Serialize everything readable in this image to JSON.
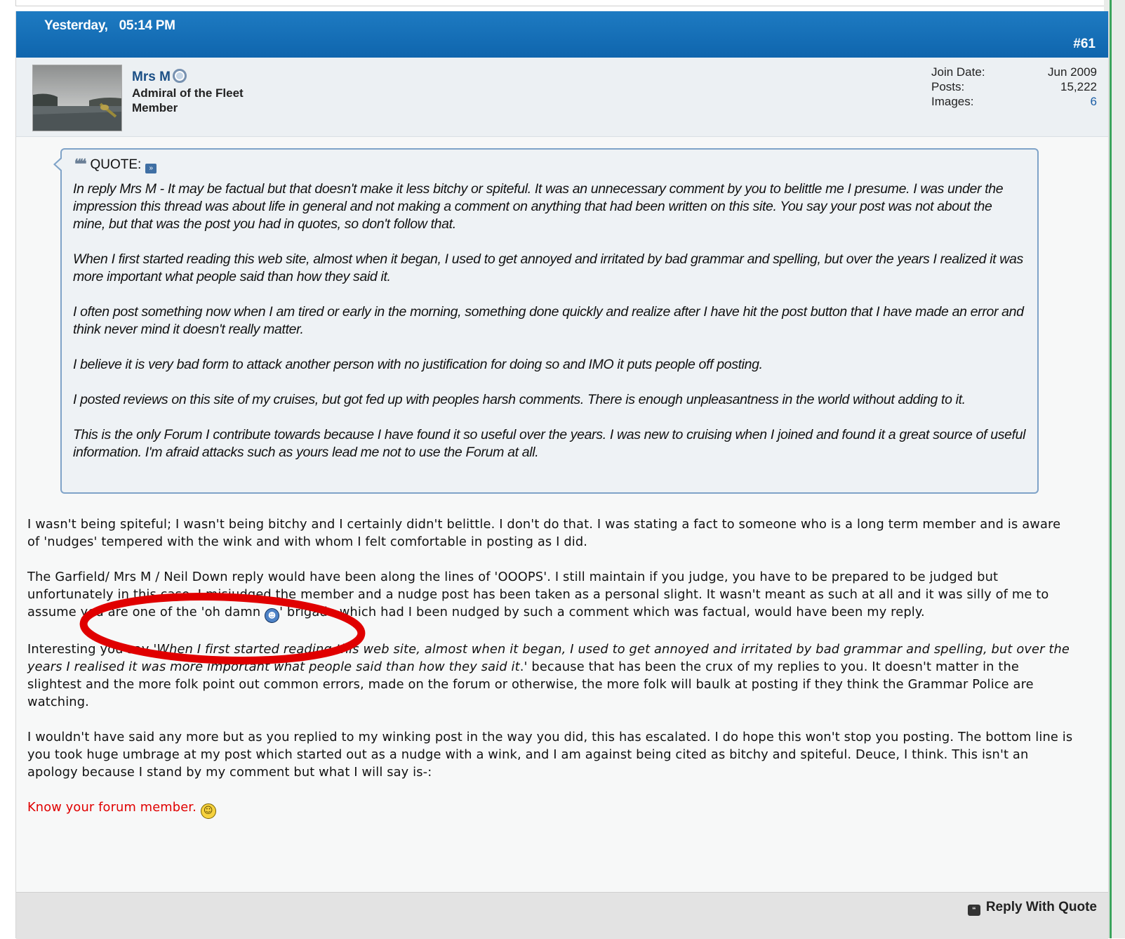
{
  "post": {
    "date": "Yesterday,",
    "time": "05:14 PM",
    "number": "#61"
  },
  "user": {
    "name": "Mrs M",
    "title_line1": "Admiral of the Fleet",
    "title_line2": "Member",
    "stats": [
      {
        "label": "Join Date:",
        "value": "Jun 2009"
      },
      {
        "label": "Posts:",
        "value": "15,222"
      },
      {
        "label": "Images:",
        "value": "6"
      }
    ]
  },
  "quote": {
    "label": "QUOTE:",
    "paragraphs": [
      "In reply Mrs M - It may be factual but that doesn't make it less bitchy or spiteful. It was an unnecessary comment by you to belittle me I presume. I was under the impression this thread was about life in general and not making a comment on anything that had been written on this site. You say your post was not about the mine, but that was the post you had in quotes, so don't follow that.",
      "When I first started reading this web site, almost when it began, I used to get annoyed and irritated by bad grammar and spelling, but over the years I realized it was more important what people said than how they said it.",
      "I often post something now when I am tired or early in the morning, something done quickly and realize after I have hit the post button that I have made an error and think never mind it doesn't really matter.",
      "I believe it is very bad form to attack another person with no justification for doing so and IMO it puts people off posting.",
      "I posted reviews on this site of my cruises, but got fed up with peoples harsh comments. There is enough unpleasantness in the world without adding to it.",
      "This is the only Forum I contribute towards because I have found it so useful over the years. I was new to cruising when I joined and found it a great source of useful information. I'm afraid attacks such as yours lead me not to use the Forum at all."
    ]
  },
  "message": {
    "p1": "I wasn't being spiteful; I wasn't being bitchy and I certainly didn't belittle. I don't do that. I was stating a fact to someone who is a long term member and is aware of 'nudges' tempered with the wink and with whom I felt comfortable in posting as I did.",
    "p2_a": "The Garfield/ Mrs M / Neil Down reply would have been along the lines of 'OOOPS'. I still maintain if you judge, you have to be prepared to be judged but unfortunately in this case, I misjudged the member and a nudge post has been taken as a personal slight. It wasn't meant as such at all and it was silly of me to assume you are one of the 'oh damn ",
    "p2_b": "' brigade which had I been nudged by such a comment which was factual, would have been my reply.",
    "p3_a": "Interesting you say '",
    "p3_ital": "When I first started reading this web site, almost when it began, I used to get annoyed and irritated by bad grammar and spelling, but over the years I realised it was more important what people said than how they said it",
    "p3_b": ".' because that has been the crux of my replies to you. It doesn't matter in the slightest and the more folk point out common errors, made on the forum or otherwise, the more folk will baulk at posting if they think the Grammar Police are watching.",
    "p4": "I wouldn't have said any more but as you replied to my winking post in the way you did, this has escalated. I do hope this won't stop you posting. The bottom line is you took huge umbrage at my post which started out as a nudge with a wink, and I am against being cited as bitchy and spiteful. Deuce, I think. This isn't an apology because I stand by my comment but what I will say is-:",
    "closing": "Know your forum member."
  },
  "footer": {
    "reply_label": "Reply With Quote"
  },
  "colors": {
    "header_blue": "#1470b8",
    "username_blue": "#1b4f86",
    "annotation_red": "#e00000",
    "closing_red": "#e00000"
  },
  "icons": [
    "online-status-icon",
    "quote-icon",
    "goto-post-icon",
    "grin-emoji-icon",
    "smiley-icon",
    "reply-quote-icon"
  ]
}
